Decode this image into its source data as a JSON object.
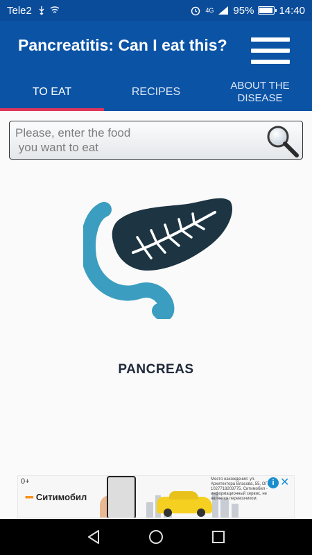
{
  "status_bar": {
    "carrier": "Tele2",
    "network": "4G",
    "battery": "95%",
    "battery_fraction": 0.95,
    "time": "14:40"
  },
  "app": {
    "title": "Pancreatitis: Can I eat this?",
    "menu_icon": "hamburger-icon"
  },
  "tabs": [
    {
      "label": "TO EAT",
      "active": true
    },
    {
      "label": "RECIPES",
      "active": false
    },
    {
      "label": "ABOUT THE\nDISEASE",
      "active": false
    }
  ],
  "search": {
    "placeholder": "Please, enter the food\n you want to eat",
    "icon": "magnifier-icon"
  },
  "main": {
    "logo_icon": "pancreas-icon",
    "caption": "PANCREAS"
  },
  "ad": {
    "age_rating": "0+",
    "brand": "Ситимобил",
    "fine_print": "Место нахождения: ул. Архитектора Власова, 55, ОГРН 1027718203775. Ситимобил - информационный сервис, не является перевозчиком.",
    "info_icon": "info-icon",
    "close_icon": "close-icon"
  },
  "nav": {
    "back_icon": "back-icon",
    "home_icon": "home-icon",
    "recents_icon": "recents-icon"
  },
  "colors": {
    "app_bar": "#0a53a5",
    "tab_indicator": "#e0355b",
    "logo_dark": "#1d3442",
    "logo_light": "#3b9ec0"
  }
}
